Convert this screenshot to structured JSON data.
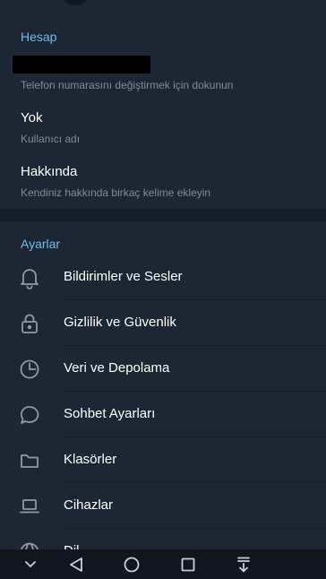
{
  "account": {
    "section_title": "Hesap",
    "phone_hint": "Telefon numarasını değiştirmek için dokunun",
    "username_value": "Yok",
    "username_label": "Kullanıcı adı",
    "about_title": "Hakkında",
    "about_hint": "Kendiniz hakkında birkaç kelime ekleyin"
  },
  "settings": {
    "section_title": "Ayarlar",
    "items": [
      {
        "label": "Bildirimler ve Sesler",
        "icon": "bell-icon"
      },
      {
        "label": "Gizlilik ve Güvenlik",
        "icon": "lock-icon"
      },
      {
        "label": "Veri ve Depolama",
        "icon": "clock-pie-icon"
      },
      {
        "label": "Sohbet Ayarları",
        "icon": "chat-bubble-icon"
      },
      {
        "label": "Klasörler",
        "icon": "folder-icon"
      },
      {
        "label": "Cihazlar",
        "icon": "laptop-icon"
      },
      {
        "label": "Dil",
        "icon": "globe-icon"
      }
    ]
  },
  "navbar": {
    "buttons": [
      "chevron-down-icon",
      "back-triangle-icon",
      "home-circle-icon",
      "recents-square-icon",
      "notification-pull-icon"
    ]
  },
  "colors": {
    "background": "#1d2733",
    "accent": "#71baf2",
    "secondary_text": "#7f8b97",
    "navbar": "#0f161d"
  }
}
